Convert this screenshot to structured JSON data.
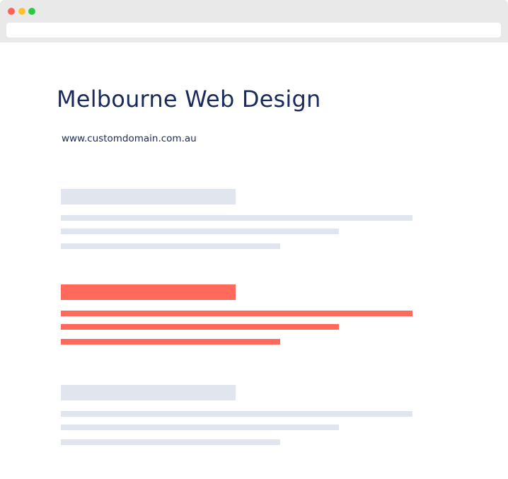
{
  "window": {
    "controls": {
      "close_color": "#ff6157",
      "minimize_color": "#ffc12f",
      "maximize_color": "#2acb42"
    },
    "address_bar": {
      "value": "",
      "placeholder": ""
    }
  },
  "page": {
    "title": "Melbourne Web Design",
    "url": "www.customdomain.com.au",
    "text_color": "#1b2a5c"
  },
  "results": [
    {
      "state": "placeholder",
      "color": "#e1e5ee"
    },
    {
      "state": "highlighted",
      "color": "#ff6a5c"
    },
    {
      "state": "placeholder",
      "color": "#e1e5ee"
    }
  ]
}
